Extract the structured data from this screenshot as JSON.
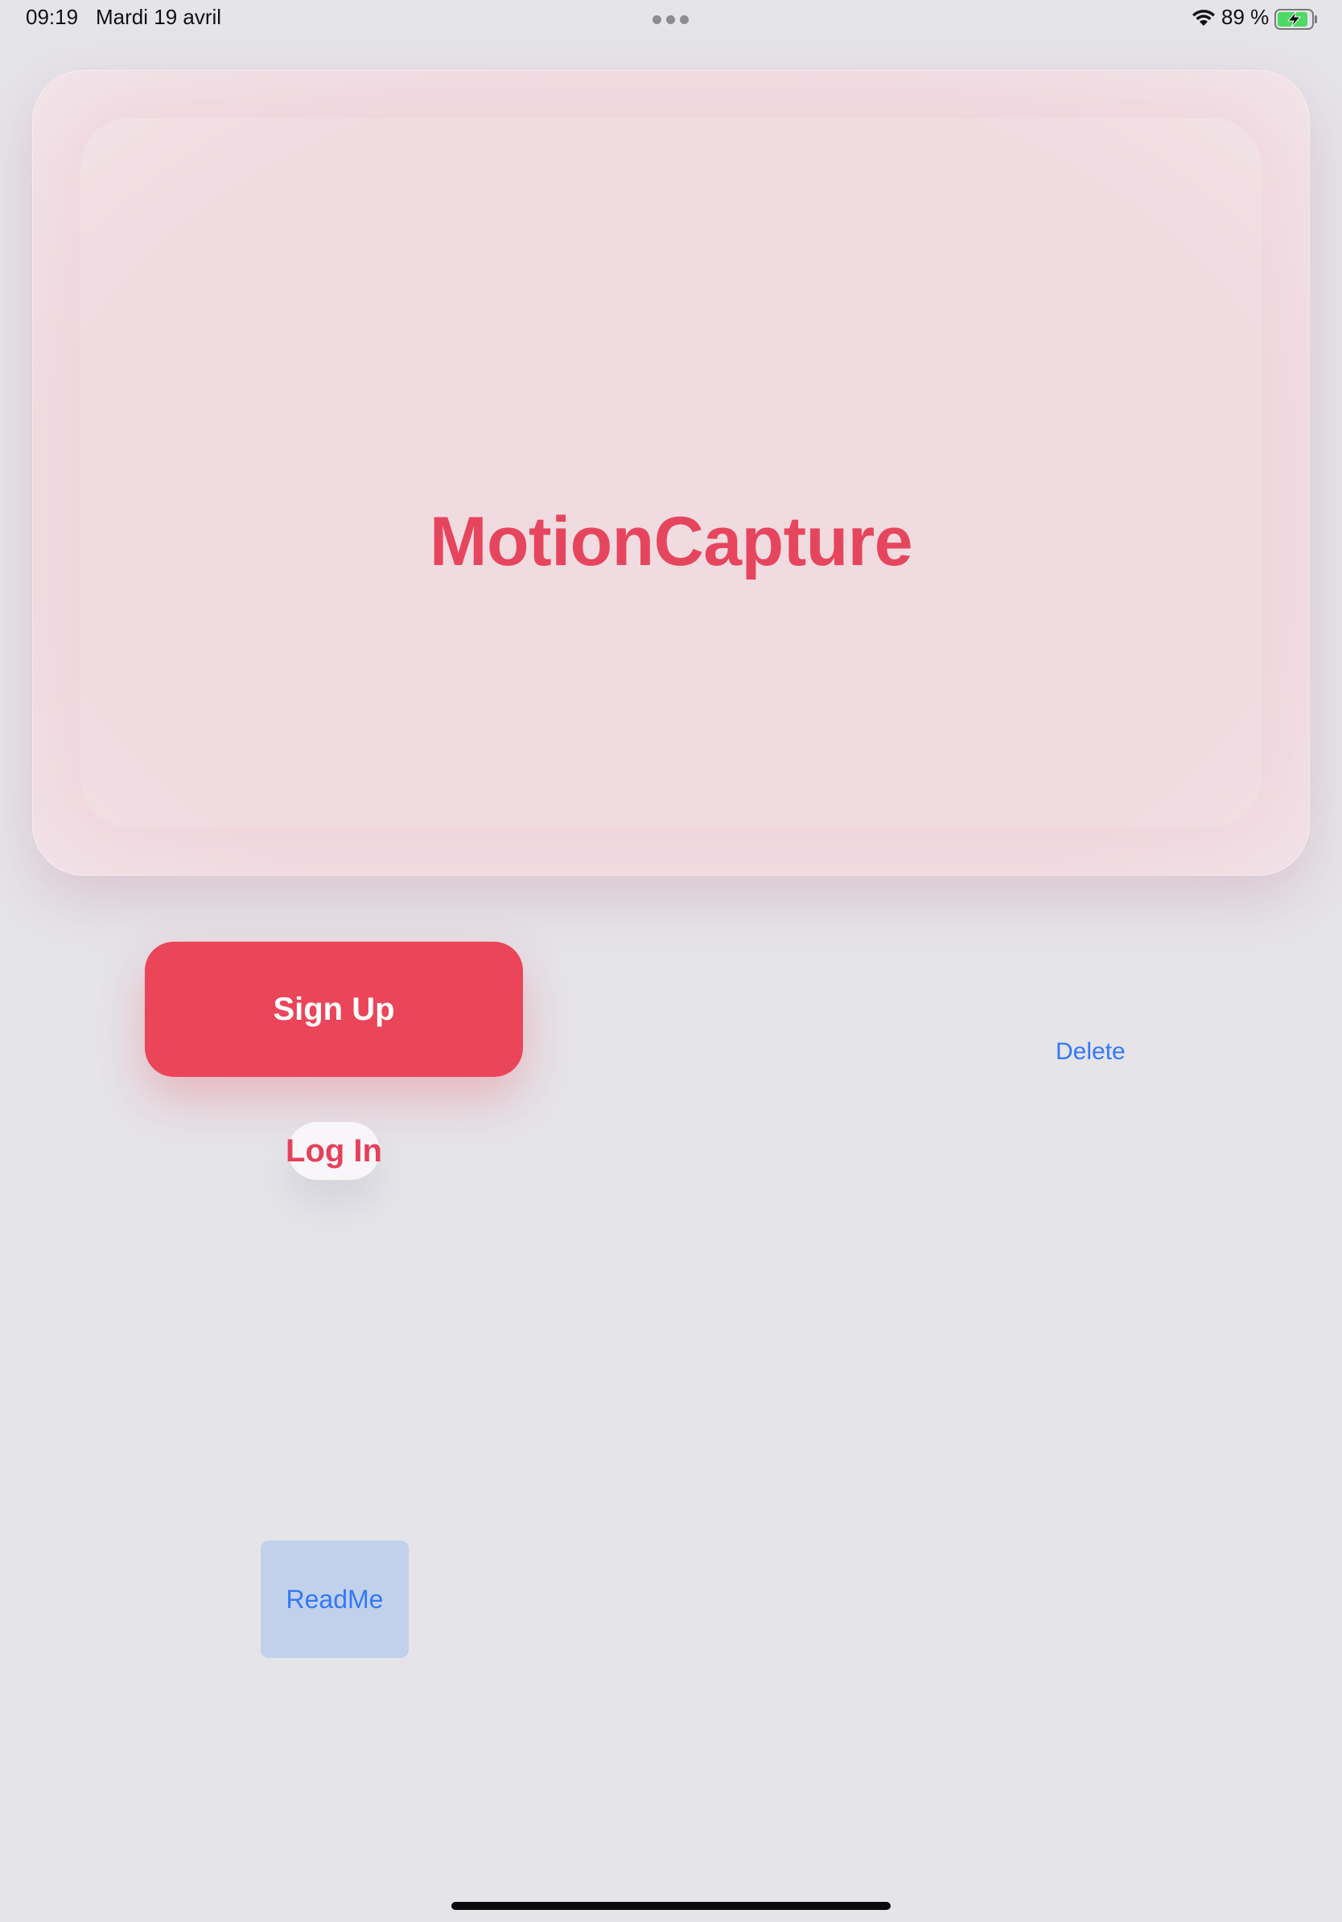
{
  "status_bar": {
    "time": "09:19",
    "date": "Mardi 19 avril",
    "battery_percent": "89 %",
    "battery_level": 0.89,
    "charging": true,
    "icons": [
      "wifi-icon",
      "battery-charging-icon",
      "multitask-dots-icon"
    ]
  },
  "hero": {
    "title": "MotionCapture"
  },
  "buttons": {
    "sign_up": "Sign Up",
    "log_in": "Log In",
    "delete": "Delete",
    "readme": "ReadMe"
  },
  "colors": {
    "accent_red": "#eb4559",
    "link_blue": "#3478f6",
    "background": "#e5e4e9",
    "battery_green": "#4cd964"
  }
}
